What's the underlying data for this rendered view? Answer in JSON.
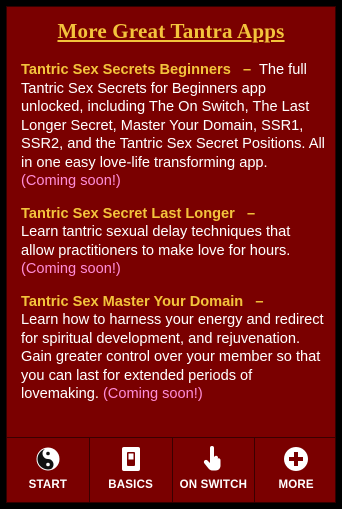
{
  "header": {
    "title": "More Great Tantra Apps"
  },
  "entries": [
    {
      "title": "Tantric Sex Secrets Beginners",
      "separator": "–",
      "description": "The full Tantric Sex Secrets for Beginners app unlocked, including The On Switch, The Last Longer Secret, Master Your Domain, SSR1, SSR2, and the Tantric Sex Secret Positions. All in one easy love-life transforming app.",
      "status": "(Coming soon!)"
    },
    {
      "title": "Tantric Sex Secret Last Longer",
      "separator": "–",
      "description": "Learn tantric sexual delay techniques that allow practitioners to make love for hours.",
      "status": "(Coming soon!)"
    },
    {
      "title": "Tantric Sex Master Your Domain",
      "separator": "–",
      "description": "Learn how to harness your energy and redirect for spiritual development, and rejuvenation. Gain greater control over your member so that you can last for extended periods of lovemaking.",
      "status": "(Coming soon!)"
    }
  ],
  "tabbar": {
    "tabs": [
      {
        "label": "START",
        "icon": "yin-yang-icon"
      },
      {
        "label": "BASICS",
        "icon": "light-switch-icon"
      },
      {
        "label": "ON SWITCH",
        "icon": "hand-pointer-icon"
      },
      {
        "label": "MORE",
        "icon": "plus-circle-icon"
      }
    ]
  },
  "colors": {
    "background": "#7a0000",
    "accent": "#f3c33c",
    "link": "#ff8cd7",
    "text": "#ffffff"
  }
}
